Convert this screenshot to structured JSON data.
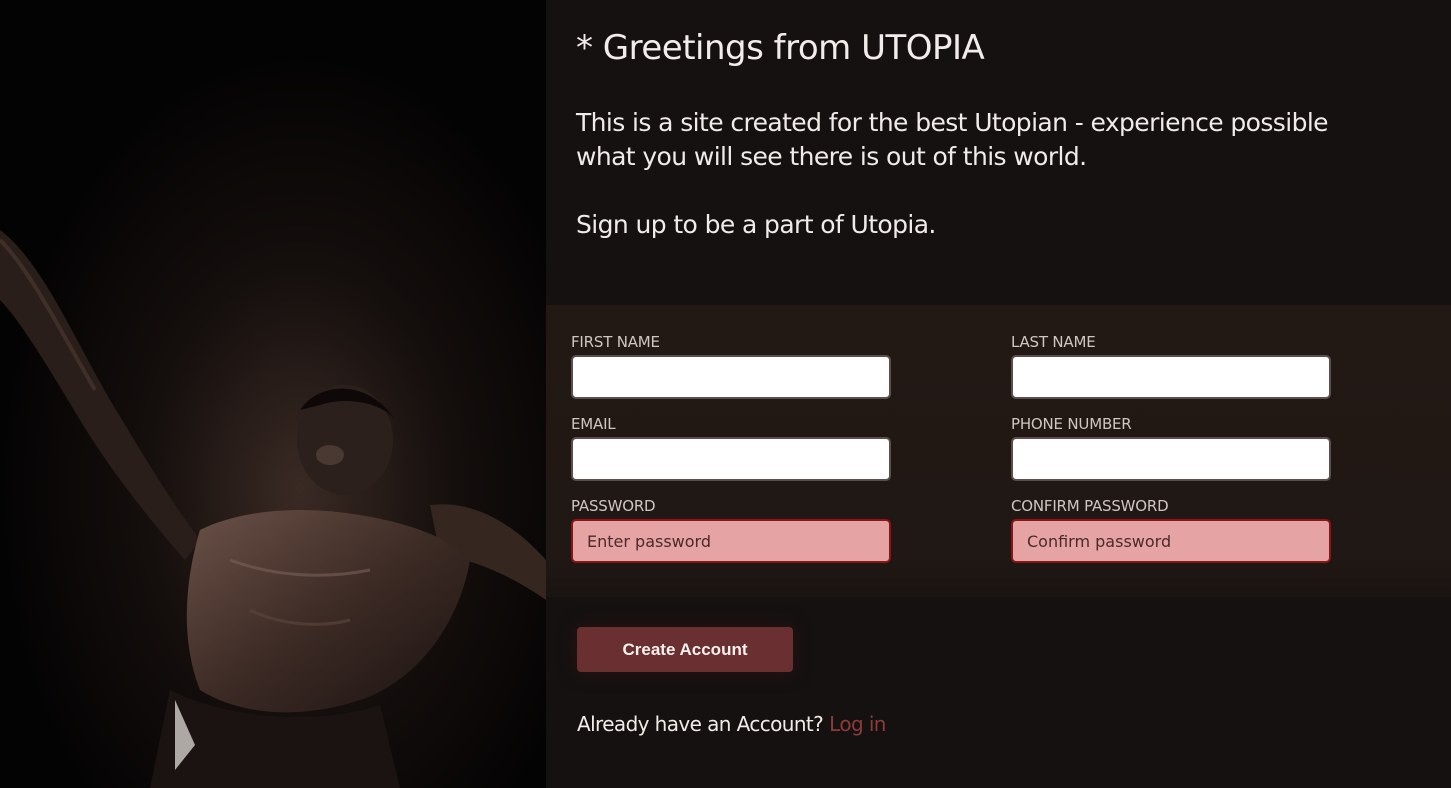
{
  "hero": {
    "image": "performer-photo"
  },
  "header": {
    "title": "* Greetings from UTOPIA"
  },
  "intro": {
    "line1": "This is a site created for the best Utopian - experience possible what you will see there is out of this world.",
    "line2": "Sign up to be a part of Utopia."
  },
  "form": {
    "first_name": {
      "label": "FIRST NAME",
      "value": "",
      "placeholder": ""
    },
    "last_name": {
      "label": "LAST NAME",
      "value": "",
      "placeholder": ""
    },
    "email": {
      "label": "EMAIL",
      "value": "",
      "placeholder": ""
    },
    "phone": {
      "label": "PHONE NUMBER",
      "value": "",
      "placeholder": ""
    },
    "password": {
      "label": "PASSWORD",
      "value": "",
      "placeholder": "Enter password",
      "state": "error"
    },
    "confirm_password": {
      "label": "CONFIRM PASSWORD",
      "value": "",
      "placeholder": "Confirm password",
      "state": "error"
    }
  },
  "actions": {
    "create_label": "Create Account",
    "login_prompt": "Already have an Account?",
    "login_link": "Log in"
  },
  "colors": {
    "accent": "#6a2f30",
    "link": "#8c3a3a",
    "error_fill": "#e6a3a4",
    "error_border": "#8a1515"
  }
}
